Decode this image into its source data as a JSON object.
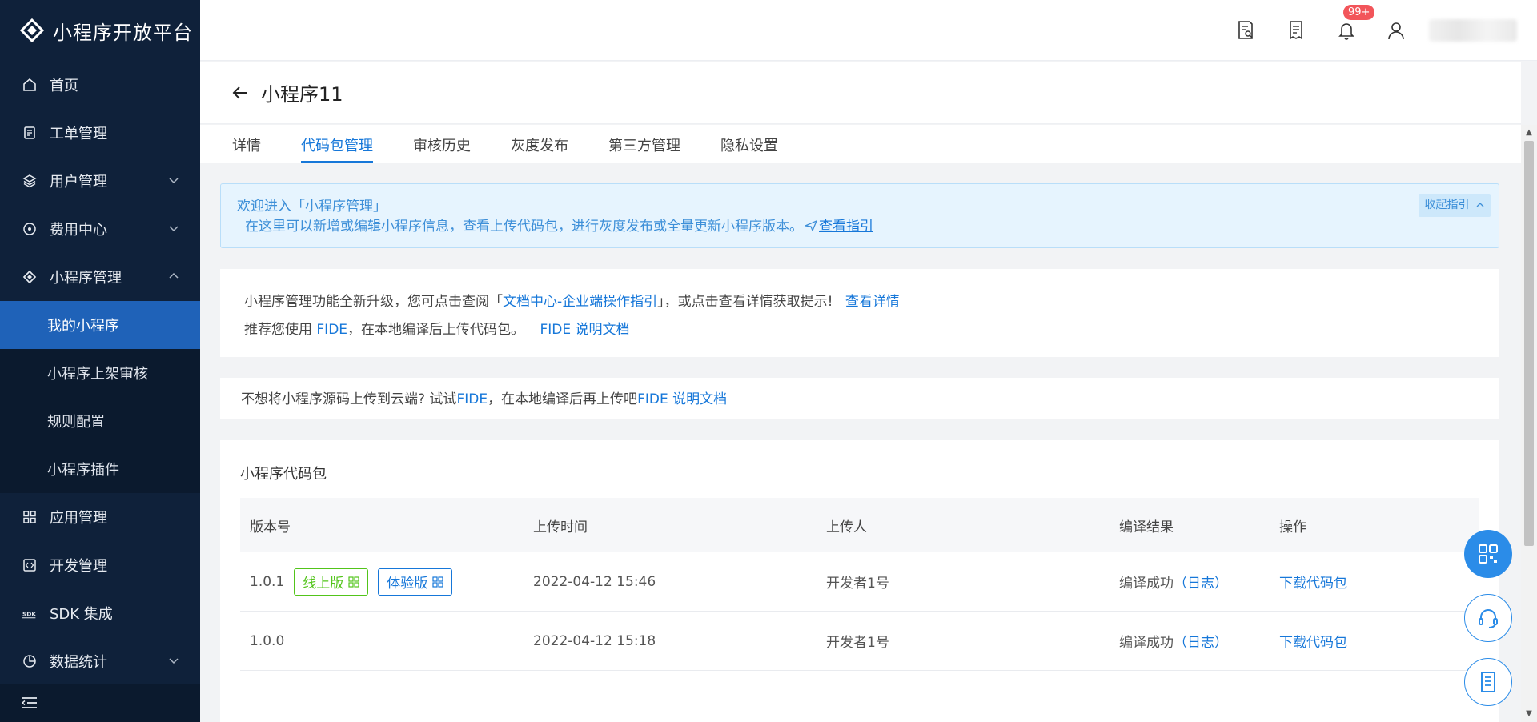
{
  "app": {
    "title": "小程序开放平台"
  },
  "sidebar": {
    "items": [
      {
        "label": "首页",
        "icon": "home-icon"
      },
      {
        "label": "工单管理",
        "icon": "ticket-icon"
      },
      {
        "label": "用户管理",
        "icon": "layers-icon"
      },
      {
        "label": "费用中心",
        "icon": "money-icon"
      },
      {
        "label": "小程序管理",
        "icon": "miniapp-icon"
      },
      {
        "label": "应用管理",
        "icon": "grid-icon"
      },
      {
        "label": "开发管理",
        "icon": "code-icon"
      },
      {
        "label": "SDK 集成",
        "icon": "sdk-icon"
      },
      {
        "label": "数据统计",
        "icon": "pie-chart-icon"
      }
    ],
    "submenu": [
      "我的小程序",
      "小程序上架审核",
      "规则配置",
      "小程序插件"
    ]
  },
  "topbar": {
    "badge": "99+"
  },
  "page": {
    "title": "小程序11"
  },
  "tabs": [
    "详情",
    "代码包管理",
    "审核历史",
    "灰度发布",
    "第三方管理",
    "隐私设置"
  ],
  "guide": {
    "line1": "欢迎进入「小程序管理」",
    "line2": "在这里可以新增或编辑小程序信息，查看上传代码包，进行灰度发布或全量更新小程序版本。",
    "link": "查看指引",
    "toggle": "收起指引"
  },
  "notice1": {
    "text_a": "小程序管理功能全新升级，您可点击查阅「",
    "doc_link": "文档中心-企业端操作指引",
    "text_b": "」，或点击查看详情获取提示!",
    "detail_link": "查看详情",
    "text_c": "推荐您使用",
    "fide": "FIDE",
    "text_d": "，在本地编译后上传代码包。",
    "fide_doc": "FIDE 说明文档"
  },
  "notice2": {
    "text_a": "不想将小程序源码上传到云端? 试试",
    "fide": "FIDE",
    "text_b": "，在本地编译后再上传吧",
    "fide_doc": "FIDE 说明文档"
  },
  "package": {
    "title": "小程序代码包",
    "columns": [
      "版本号",
      "上传时间",
      "上传人",
      "编译结果",
      "操作"
    ],
    "rows": [
      {
        "version": "1.0.1",
        "tags": [
          "线上版",
          "体验版"
        ],
        "time": "2022-04-12 15:46",
        "uploader": "开发者1号",
        "result": "编译成功",
        "log": "（日志）",
        "action": "下载代码包"
      },
      {
        "version": "1.0.0",
        "tags": [],
        "time": "2022-04-12 15:18",
        "uploader": "开发者1号",
        "result": "编译成功",
        "log": "（日志）",
        "action": "下载代码包"
      }
    ]
  },
  "colors": {
    "sidebar": "#0f213a",
    "active": "#1f62b8",
    "accent": "#1677d9",
    "success": "#52c41a",
    "badge": "#f2555a"
  }
}
